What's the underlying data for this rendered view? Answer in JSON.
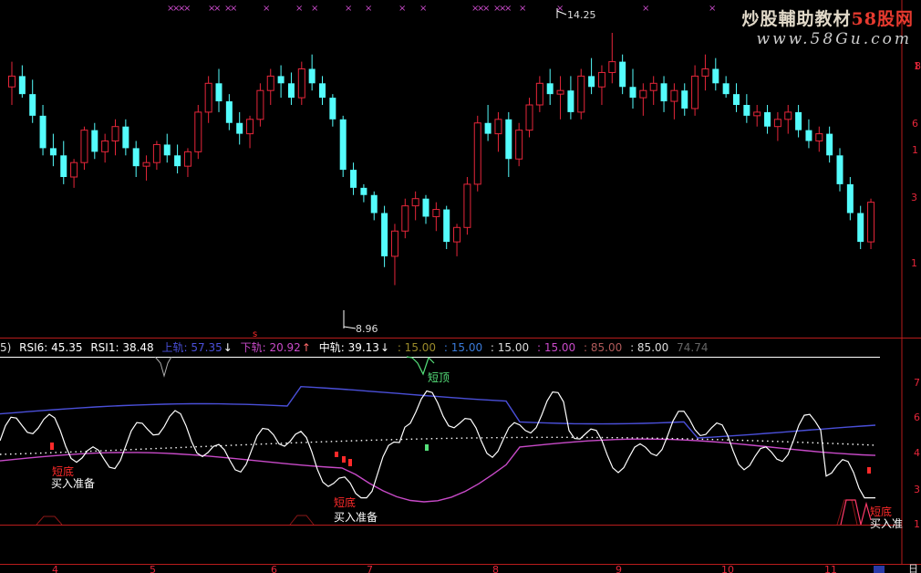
{
  "watermark": {
    "line1_pre": "炒股輔助教材",
    "line1_brand": "58股网",
    "line2": "www.58Gu.com"
  },
  "price_panel": {
    "high_label": "14.25",
    "low_label": "8.96",
    "right_axis_fragments": [
      "1",
      "8",
      "6",
      "1",
      "3",
      "1"
    ]
  },
  "indicator_header": {
    "prefix": "5)",
    "rsi6": "RSI6: 45.35",
    "rsi1": "RSI1: 38.48",
    "upper": "上轨: 57.35",
    "lower": "下轨: 20.92",
    "middle": "中轨: 39.13",
    "levels": [
      ": 15.00",
      ": 15.00",
      ": 15.00",
      ": 15.00",
      ": 85.00",
      ": 85.00"
    ],
    "faded": "74.74"
  },
  "indicator_axis_fragments": [
    "7",
    "6",
    "4",
    "3",
    "1"
  ],
  "signals": {
    "buy_ready": "买入准备",
    "buy_ready_cut": "买入准",
    "short_top": "短顶",
    "low_red": "短底"
  },
  "x_axis": [
    "4",
    "5",
    "6",
    "7",
    "8",
    "9",
    "10",
    "11"
  ],
  "corner_label": "日",
  "colors": {
    "up": "#e6263a",
    "down": "#54fcfc",
    "rsi": "#ffffff",
    "upper": "#4a4fd8",
    "lower": "#c84ac8",
    "middle": "#ffffff",
    "signal_red": "#ff2a2a",
    "signal_green": "#55e07a",
    "border": "#b81c1c"
  },
  "candles": [
    [
      65,
      72,
      60,
      68
    ],
    [
      68,
      71,
      62,
      63
    ],
    [
      63,
      67,
      55,
      57
    ],
    [
      57,
      60,
      46,
      48
    ],
    [
      48,
      52,
      43,
      46
    ],
    [
      46,
      50,
      38,
      40
    ],
    [
      40,
      45,
      37,
      44
    ],
    [
      44,
      54,
      42,
      53
    ],
    [
      53,
      55,
      45,
      47
    ],
    [
      47,
      52,
      44,
      50
    ],
    [
      50,
      56,
      46,
      54
    ],
    [
      54,
      56,
      46,
      48
    ],
    [
      48,
      50,
      40,
      43
    ],
    [
      43,
      46,
      39,
      44
    ],
    [
      44,
      50,
      42,
      49
    ],
    [
      49,
      52,
      44,
      46
    ],
    [
      46,
      49,
      41,
      43
    ],
    [
      43,
      48,
      40,
      47
    ],
    [
      47,
      60,
      45,
      58
    ],
    [
      58,
      68,
      55,
      66
    ],
    [
      66,
      70,
      58,
      61
    ],
    [
      61,
      63,
      53,
      55
    ],
    [
      55,
      58,
      49,
      52
    ],
    [
      52,
      57,
      48,
      56
    ],
    [
      56,
      66,
      54,
      64
    ],
    [
      64,
      70,
      60,
      68
    ],
    [
      68,
      71,
      62,
      66
    ],
    [
      66,
      69,
      60,
      62
    ],
    [
      62,
      72,
      60,
      70
    ],
    [
      70,
      74,
      64,
      66
    ],
    [
      66,
      68,
      60,
      62
    ],
    [
      62,
      63,
      54,
      56
    ],
    [
      56,
      57,
      40,
      42
    ],
    [
      42,
      44,
      35,
      37
    ],
    [
      37,
      38,
      33,
      35
    ],
    [
      35,
      36,
      28,
      30
    ],
    [
      30,
      32,
      15,
      18
    ],
    [
      18,
      27,
      10,
      25
    ],
    [
      25,
      34,
      23,
      32
    ],
    [
      32,
      36,
      28,
      34
    ],
    [
      34,
      35,
      27,
      29
    ],
    [
      29,
      33,
      25,
      31
    ],
    [
      31,
      32,
      20,
      22
    ],
    [
      22,
      27,
      18,
      26
    ],
    [
      26,
      40,
      24,
      38
    ],
    [
      38,
      57,
      36,
      55
    ],
    [
      55,
      60,
      50,
      52
    ],
    [
      52,
      58,
      47,
      56
    ],
    [
      56,
      58,
      40,
      45
    ],
    [
      45,
      55,
      43,
      53
    ],
    [
      53,
      62,
      51,
      60
    ],
    [
      60,
      68,
      58,
      66
    ],
    [
      66,
      70,
      60,
      63
    ],
    [
      63,
      68,
      56,
      64
    ],
    [
      64,
      68,
      56,
      58
    ],
    [
      58,
      70,
      56,
      68
    ],
    [
      68,
      73,
      63,
      65
    ],
    [
      65,
      71,
      60,
      69
    ],
    [
      69,
      80,
      66,
      72
    ],
    [
      72,
      74,
      63,
      65
    ],
    [
      65,
      70,
      59,
      62
    ],
    [
      62,
      66,
      57,
      64
    ],
    [
      64,
      68,
      60,
      66
    ],
    [
      66,
      68,
      58,
      61
    ],
    [
      61,
      66,
      56,
      64
    ],
    [
      64,
      66,
      57,
      59
    ],
    [
      59,
      71,
      57,
      68
    ],
    [
      68,
      74,
      64,
      70
    ],
    [
      70,
      73,
      64,
      66
    ],
    [
      66,
      68,
      62,
      63
    ],
    [
      63,
      66,
      58,
      60
    ],
    [
      60,
      63,
      55,
      57
    ],
    [
      57,
      60,
      54,
      58
    ],
    [
      58,
      60,
      52,
      54
    ],
    [
      54,
      58,
      50,
      56
    ],
    [
      56,
      60,
      52,
      58
    ],
    [
      58,
      60,
      51,
      53
    ],
    [
      53,
      56,
      48,
      50
    ],
    [
      50,
      54,
      47,
      52
    ],
    [
      52,
      54,
      44,
      46
    ],
    [
      46,
      48,
      36,
      38
    ],
    [
      38,
      40,
      28,
      30
    ],
    [
      30,
      32,
      20,
      22
    ],
    [
      22,
      34,
      20,
      33
    ]
  ]
}
